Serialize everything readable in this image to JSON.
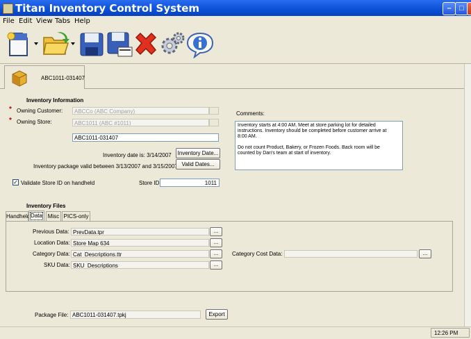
{
  "window": {
    "title": "Titan Inventory Control System"
  },
  "menu": {
    "items": [
      "File",
      "Edit",
      "View",
      "Tabs",
      "Help"
    ]
  },
  "toolbar": {
    "icons": [
      "new-document-icon",
      "open-folder-icon",
      "save-icon",
      "save-as-icon",
      "delete-icon",
      "settings-gears-icon",
      "info-icon"
    ]
  },
  "package_tab": {
    "label": "ABC1011-031407"
  },
  "inventory_info": {
    "heading": "Inventory Information",
    "owning_customer_label": "Owning Customer:",
    "owning_customer_value": "ABCCo (ABC Company)",
    "owning_store_label": "Owning Store:",
    "owning_store_value": "ABC1011 (ABC #1011)",
    "package_name_value": "ABC1011-031407",
    "inventory_date_text": "Inventory date is: 3/14/2007",
    "inventory_date_button": "Inventory Date...",
    "valid_between_text": "Inventory package valid between 3/13/2007 and 3/15/2007",
    "valid_dates_button": "Valid Dates...",
    "validate_checkbox_label": "Validate Store ID on handheld",
    "validate_checked": true,
    "store_id_label": "Store ID:",
    "store_id_value": "1011",
    "comments_label": "Comments:",
    "comments_line1": "Inventory starts at 4:00 AM.  Meet at store parking lot for detailed",
    "comments_line2": "instructions.  Inventory should be completed before customer arrive at",
    "comments_line3": "8:00 AM.",
    "comments_line4": "Do not count Product, Bakery, or Frozen Foods.  Back room will be",
    "comments_line5": "counted by Dan's team at start of inventory."
  },
  "inventory_files": {
    "heading": "Inventory Files",
    "tabs": [
      "Handheld",
      "Data",
      "Misc",
      "PICS-only"
    ],
    "active_tab": "Data",
    "previous_data_label": "Previous Data:",
    "previous_data_value": "PrevData.tpr",
    "location_data_label": "Location Data:",
    "location_data_value": "Store Map 634",
    "category_data_label": "Category Data:",
    "category_data_value": "Cat_Descriptions.ttr",
    "sku_data_label": "SKU Data:",
    "sku_data_value": "SKU_Descriptions",
    "category_cost_label": "Category Cost Data:",
    "category_cost_value": "",
    "browse_label": "..."
  },
  "package_file": {
    "label": "Package File:",
    "value": "ABC1011-031407.tpkj",
    "export_button": "Export"
  },
  "status": {
    "time": "12:26 PM"
  }
}
